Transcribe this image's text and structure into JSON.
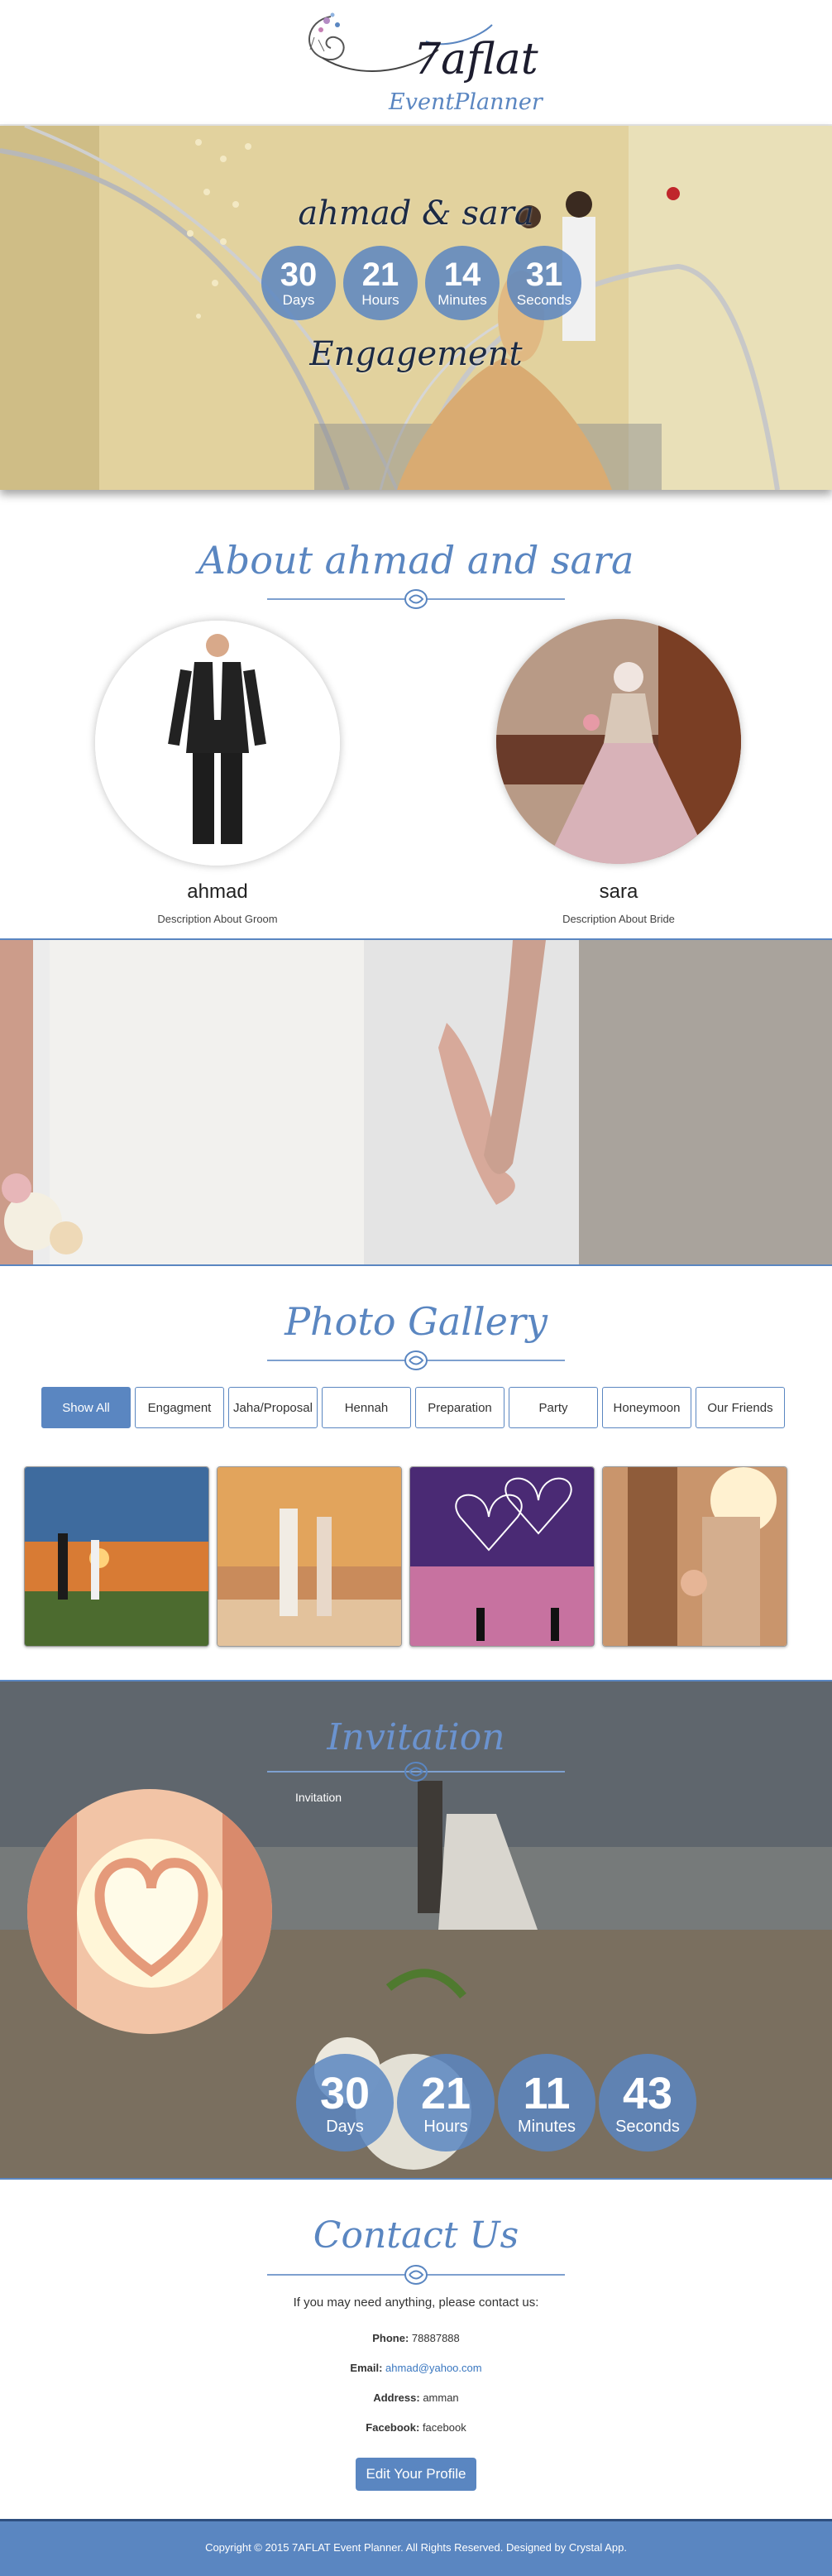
{
  "brand": {
    "logo_main": "7aflat",
    "logo_sub": "EventPlanner",
    "accent_color": "#5a86c1"
  },
  "hero": {
    "couple_title": "ahmad & sara",
    "event_name": "Engagement",
    "countdown": [
      {
        "value": "30",
        "label": "Days"
      },
      {
        "value": "21",
        "label": "Hours"
      },
      {
        "value": "14",
        "label": "Minutes"
      },
      {
        "value": "31",
        "label": "Seconds"
      }
    ]
  },
  "about": {
    "title": "About ahmad and sara",
    "groom": {
      "name": "ahmad",
      "description": "Description About Groom"
    },
    "bride": {
      "name": "sara",
      "description": "Description About Bride"
    }
  },
  "gallery": {
    "title": "Photo Gallery",
    "filters": [
      "Show All",
      "Engagment",
      "Jaha/Proposal",
      "Hennah",
      "Preparation",
      "Party",
      "Honeymoon",
      "Our Friends"
    ],
    "active_filter": "Show All"
  },
  "invitation": {
    "title": "Invitation",
    "text": "Invitation",
    "countdown": [
      {
        "value": "30",
        "label": "Days"
      },
      {
        "value": "21",
        "label": "Hours"
      },
      {
        "value": "11",
        "label": "Minutes"
      },
      {
        "value": "43",
        "label": "Seconds"
      }
    ]
  },
  "contact": {
    "title": "Contact Us",
    "intro": "If you may need anything, please contact us:",
    "phone_label": "Phone:",
    "phone": "78887888",
    "email_label": "Email:",
    "email": "ahmad@yahoo.com",
    "address_label": "Address:",
    "address": "amman",
    "facebook_label": "Facebook:",
    "facebook": "facebook",
    "edit_button": "Edit Your Profile"
  },
  "footer": {
    "copyright": "Copyright © 2015 7AFLAT Event Planner. All Rights Reserved. Designed by Crystal App."
  }
}
